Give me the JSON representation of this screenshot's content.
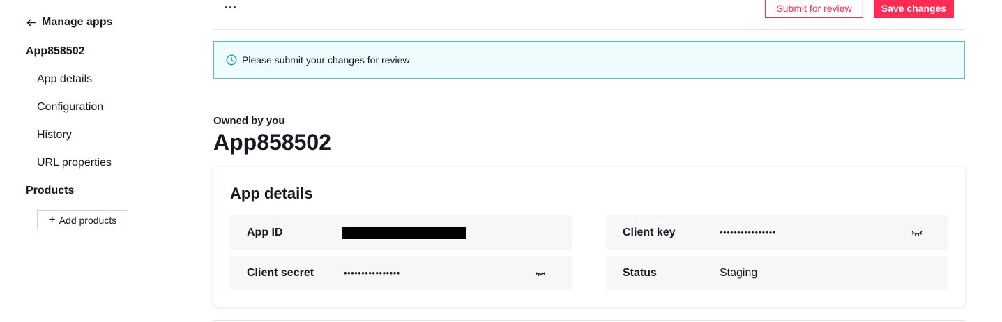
{
  "sidebar": {
    "back_label": "Manage apps",
    "app_name": "App858502",
    "items": [
      {
        "label": "App details"
      },
      {
        "label": "Configuration"
      },
      {
        "label": "History"
      },
      {
        "label": "URL properties"
      }
    ],
    "products_heading": "Products",
    "add_products_label": "Add products"
  },
  "header": {
    "more_label": "...",
    "submit_label": "Submit for review",
    "save_label": "Save changes"
  },
  "notice": {
    "text": "Please submit your changes for review"
  },
  "main": {
    "owned_label": "Owned by you",
    "title": "App858502"
  },
  "details": {
    "title": "App details",
    "app_id_label": "App ID",
    "client_key_label": "Client key",
    "client_key_masked": "••••••••••••••••",
    "client_secret_label": "Client secret",
    "client_secret_masked": "••••••••••••••••",
    "status_label": "Status",
    "status_value": "Staging"
  },
  "colors": {
    "brand": "#fe2c55",
    "notice_bg": "#effcfd",
    "notice_border": "#47c5d1"
  },
  "icons": [
    "arrow-left-icon",
    "clock-icon",
    "plus-icon",
    "eye-closed-icon"
  ]
}
